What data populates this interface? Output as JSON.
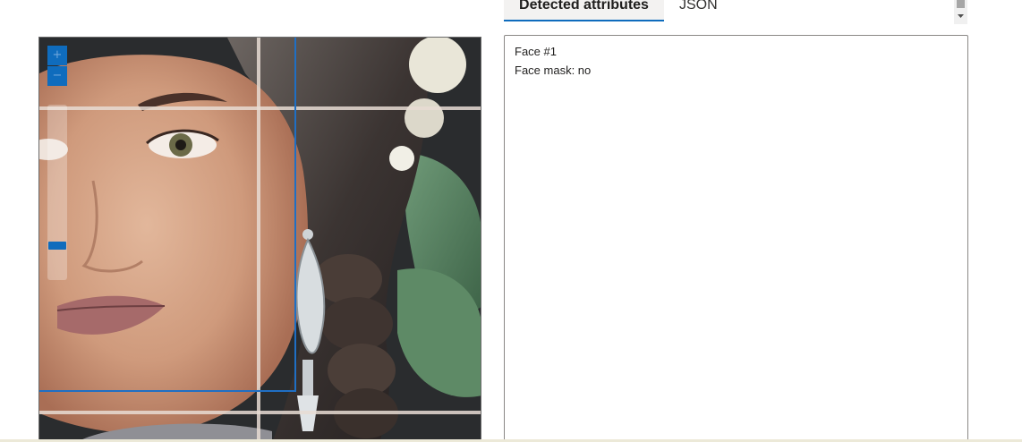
{
  "viewer": {
    "zoom_in_label": "+",
    "zoom_out_label": "−",
    "zoom_level": 0.82
  },
  "tabs": [
    {
      "label": "Detected attributes",
      "selected": true
    },
    {
      "label": "JSON",
      "selected": false
    }
  ],
  "results": {
    "lines": [
      "Face #1",
      "Face mask: no"
    ]
  },
  "icons": {
    "scroll_down": "triangle-down-icon"
  },
  "colors": {
    "accent": "#0f6cbd",
    "face_box": "#1f6fc4"
  }
}
